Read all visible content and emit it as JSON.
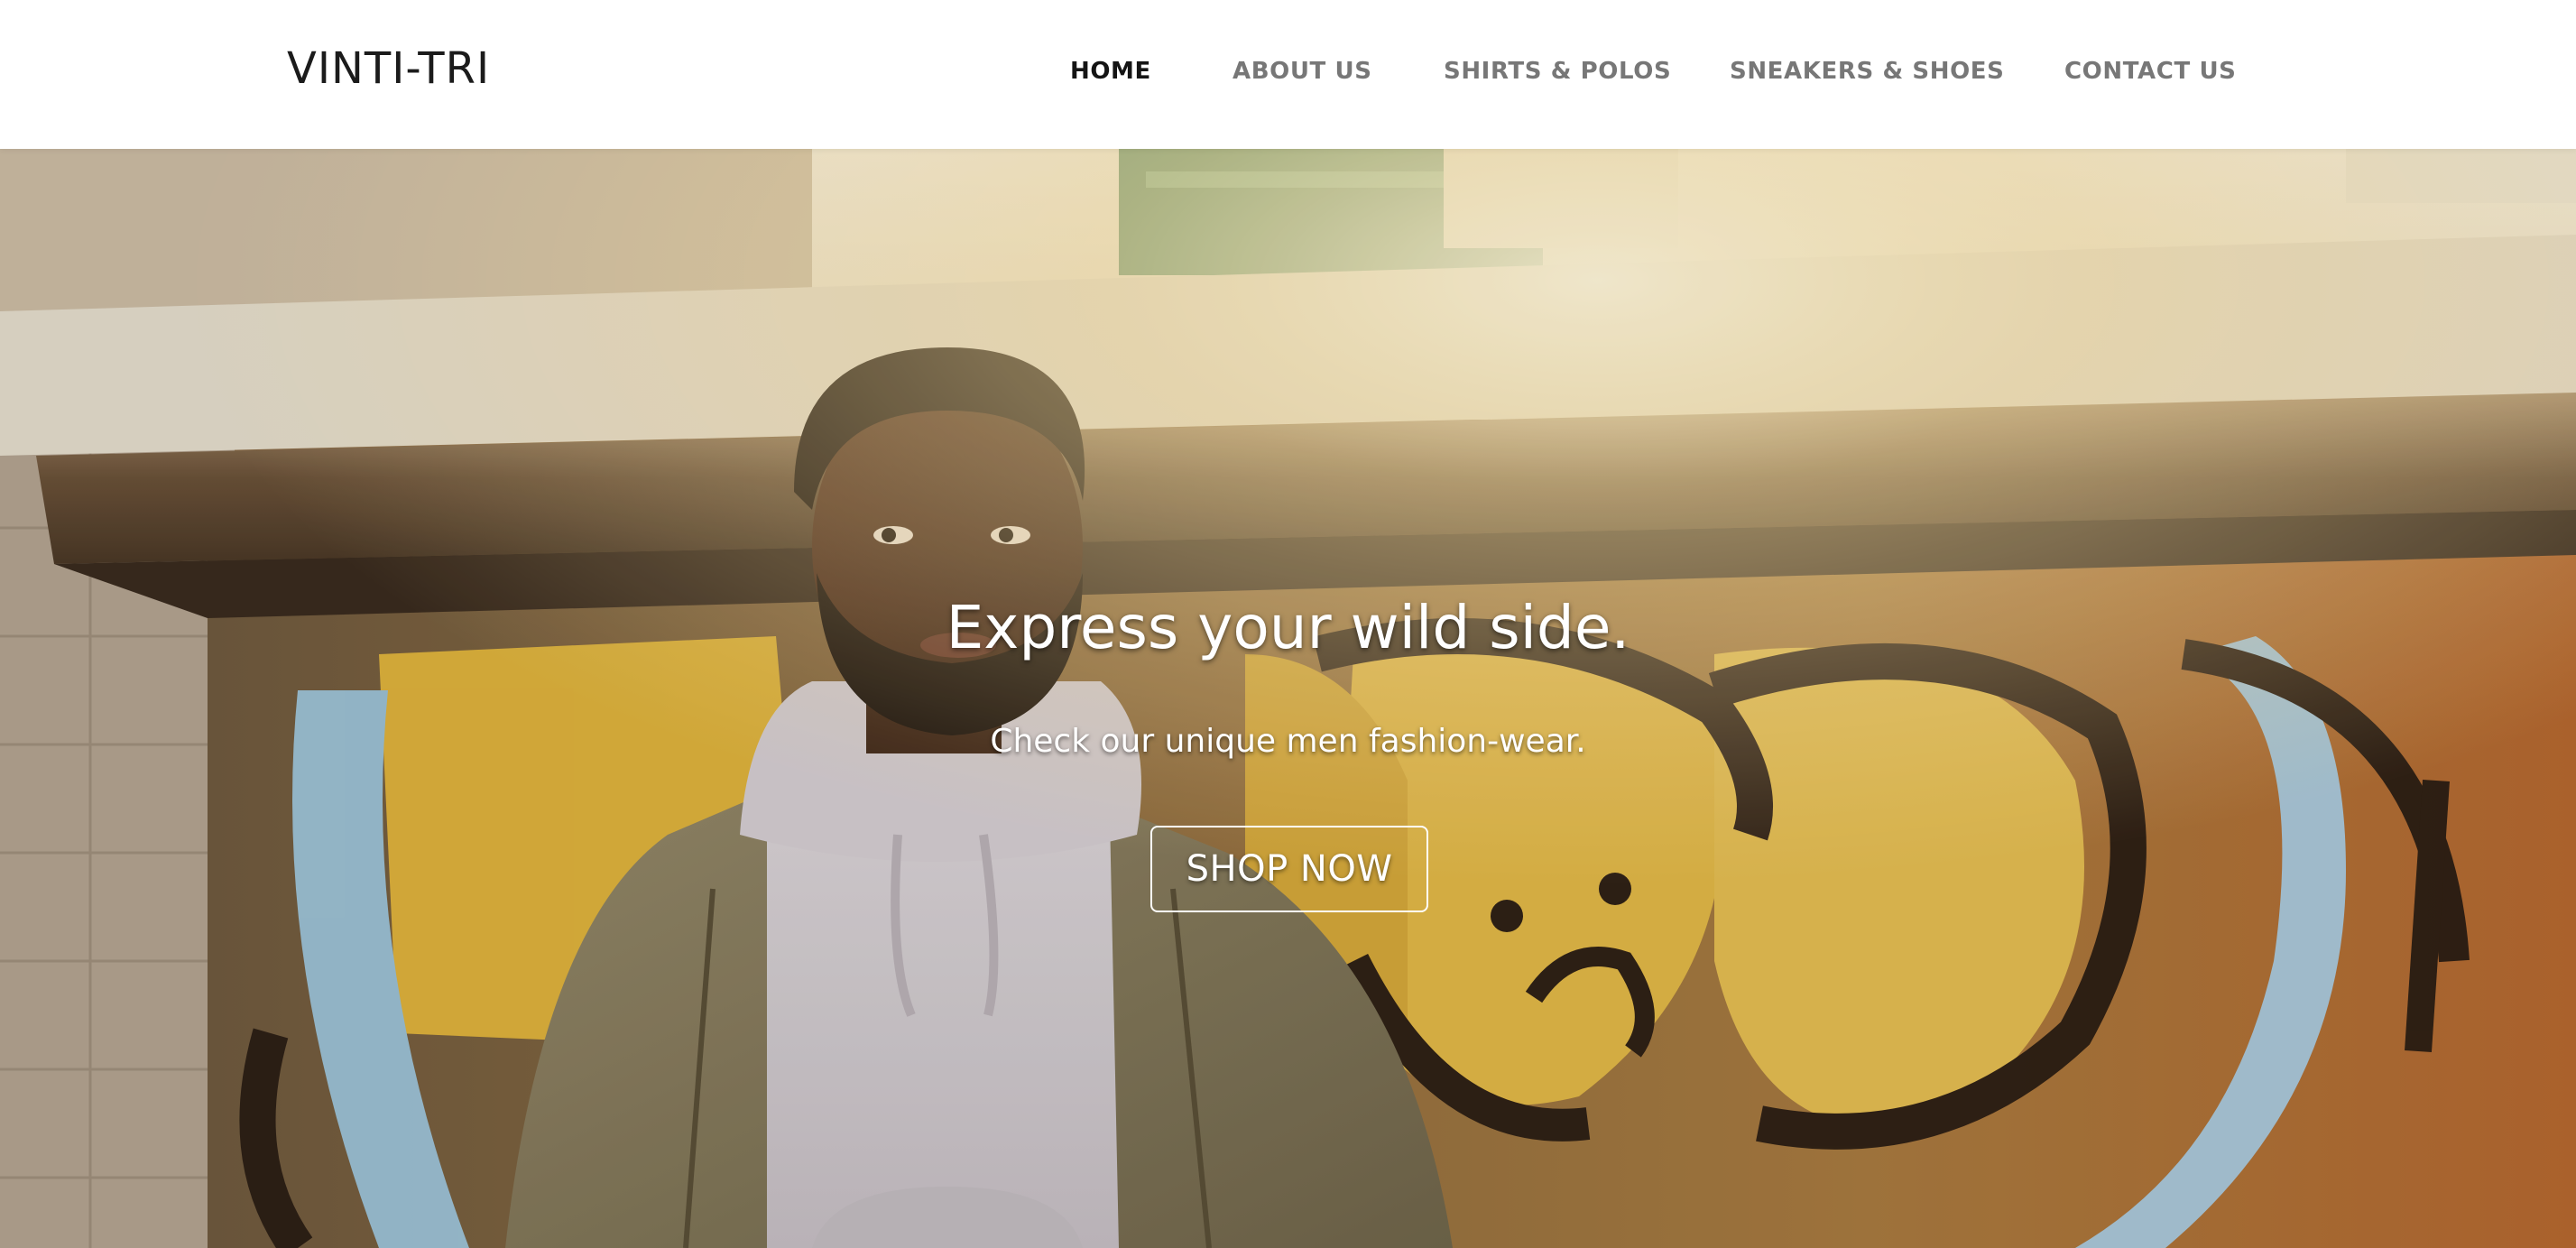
{
  "brand": {
    "name": "VINTI-TRI"
  },
  "nav": {
    "items": [
      {
        "label": "HOME",
        "active": true
      },
      {
        "label": "ABOUT US",
        "active": false
      },
      {
        "label": "SHIRTS & POLOS",
        "active": false
      },
      {
        "label": "SNEAKERS & SHOES",
        "active": false
      },
      {
        "label": "CONTACT US",
        "active": false
      }
    ]
  },
  "hero": {
    "title": "Express your wild side.",
    "subtitle": "Check our unique men fashion-wear.",
    "cta_label": "SHOP NOW",
    "image_subject": "man-in-hoodie-and-jacket-against-graffiti-wall"
  },
  "colors": {
    "nav_active": "#141414",
    "nav_inactive": "#777777",
    "hero_text": "#ffffff",
    "graffiti_yellow": "#e8bd46",
    "graffiti_orange": "#b56a34"
  }
}
